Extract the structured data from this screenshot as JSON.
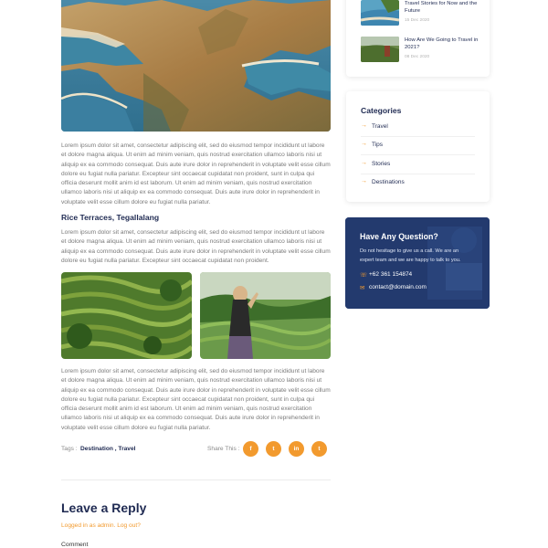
{
  "article": {
    "paragraph_1": "Lorem ipsum dolor sit amet, consectetur adipiscing elit, sed do eiusmod tempor incididunt ut labore et dolore magna aliqua. Ut enim ad minim veniam, quis nostrud exercitation ullamco laboris nisi ut aliquip ex ea commodo consequat. Duis aute irure dolor in reprehenderit in voluptate velit esse cillum dolore eu fugiat nulla pariatur. Excepteur sint occaecat cupidatat non proident, sunt in culpa qui officia deserunt mollit anim id est laborum. Ut enim ad minim veniam, quis nostrud exercitation ullamco laboris nisi ut aliquip ex ea commodo consequat. Duis aute irure dolor in reprehenderit in voluptate velit esse cillum dolore eu fugiat nulla pariatur.",
    "subheading": "Rice Terraces, Tegallalang",
    "paragraph_2": "Lorem ipsum dolor sit amet, consectetur adipiscing elit, sed do eiusmod tempor incididunt ut labore et dolore magna aliqua. Ut enim ad minim veniam, quis nostrud exercitation ullamco laboris nisi ut aliquip ex ea commodo consequat. Duis aute irure dolor in reprehenderit in voluptate velit esse cillum dolore eu fugiat nulla pariatur. Excepteur sint occaecat cupidatat non proident.",
    "paragraph_3": "Lorem ipsum dolor sit amet, consectetur adipiscing elit, sed do eiusmod tempor incididunt ut labore et dolore magna aliqua. Ut enim ad minim veniam, quis nostrud exercitation ullamco laboris nisi ut aliquip ex ea commodo consequat. Duis aute irure dolor in reprehenderit in voluptate velit esse cillum dolore eu fugiat nulla pariatur. Excepteur sint occaecat cupidatat non proident, sunt in culpa qui officia deserunt mollit anim id est laborum. Ut enim ad minim veniam, quis nostrud exercitation ullamco laboris nisi ut aliquip ex ea commodo consequat. Duis aute irure dolor in reprehenderit in voluptate velit esse cillum dolore eu fugiat nulla pariatur."
  },
  "tags": {
    "label": "Tags :",
    "items": [
      "Destination",
      "Travel"
    ],
    "separator": " , "
  },
  "share": {
    "label": "Share This :",
    "icons": [
      "facebook-icon",
      "twitter-icon",
      "linkedin-icon",
      "tumblr-icon"
    ],
    "glyphs": [
      "f",
      "t",
      "in",
      "t"
    ]
  },
  "reply": {
    "title": "Leave a Reply",
    "logged_in": "Logged in as admin. Log out?",
    "comment_label": "Comment"
  },
  "sidebar": {
    "recent_posts": [
      {
        "title": "Travel Stories for Now and the Future",
        "date": "15 Dec 2020"
      },
      {
        "title": "How Are We Going to Travel in 2021?",
        "date": "08 Dec 2020"
      }
    ],
    "categories_title": "Categories",
    "categories": [
      "Travel",
      "Tips",
      "Stories",
      "Destinations"
    ],
    "category_arrow": "→",
    "question": {
      "title": "Have Any Question?",
      "text": "Do not hesitage to give us a call. We are an expert team and we are happy to talk to you.",
      "phone": "+62 361 154874",
      "email": "contact@domain.com",
      "phone_icon": "phone-icon",
      "email_icon": "mail-icon"
    }
  },
  "colors": {
    "accent": "#f29a2e",
    "heading": "#1f2a52",
    "question_bg": "#233a6e"
  }
}
